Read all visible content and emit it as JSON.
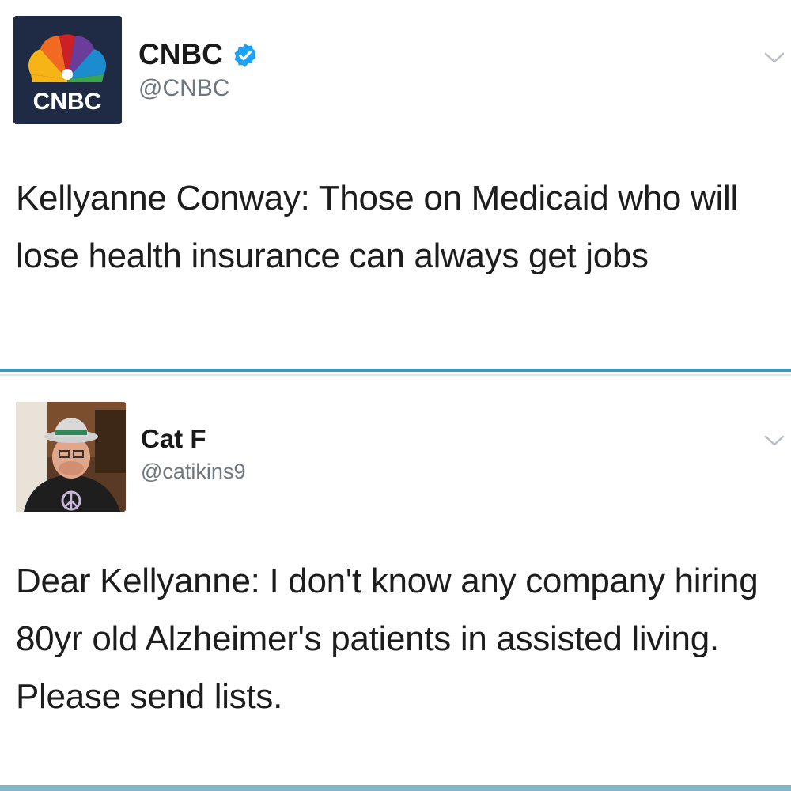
{
  "tweets": [
    {
      "display_name": "CNBC",
      "handle": "@CNBC",
      "verified": true,
      "avatar_icon": "cnbc-peacock-logo",
      "avatar_text": "CNBC",
      "body": "Kellyanne Conway: Those on Medicaid who will lose health insurance can always get jobs"
    },
    {
      "display_name": "Cat F",
      "handle": "@catikins9",
      "verified": false,
      "avatar_icon": "user-photo-avatar",
      "body": "Dear Kellyanne: I don't know any company hiring 80yr old Alzheimer's patients in assisted living. Please send lists."
    }
  ],
  "icons": {
    "verified": "verified-badge-icon",
    "menu": "chevron-down-icon"
  },
  "colors": {
    "divider": "#3e96b3",
    "verified": "#1da1f2",
    "cnbc_bg": "#1f2a44"
  }
}
